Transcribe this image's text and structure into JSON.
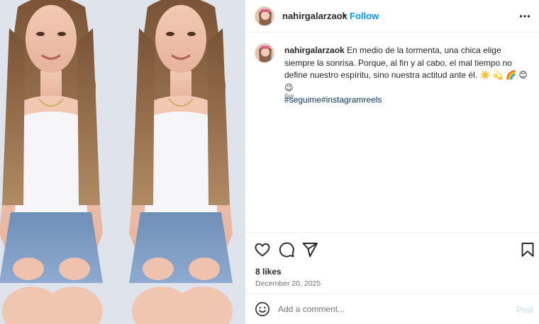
{
  "post": {
    "username": "nahirgalarzaok",
    "dot": "•",
    "follow_label": "Follow",
    "caption_text": "En medio de la tormenta, una chica elige siempre la sonrisa. Porque, al fin y al cabo, el mal tiempo no define nuestro espíritu, sino nuestra actitud ante él. ☀️ 💫 🌈 😊 😉",
    "hashtags": "#seguime#instagramreels",
    "time_ago": "6w",
    "likes": "8 likes",
    "date": "December 20, 2025"
  },
  "comment": {
    "placeholder": "Add a comment...",
    "post_label": "Post"
  },
  "icons": {
    "more": "more-options-icon",
    "like": "heart-icon",
    "comment": "comment-icon",
    "share": "send-icon",
    "save": "bookmark-icon",
    "emoji": "emoji-icon"
  },
  "colors": {
    "accent": "#0095f6",
    "hashtag": "#00376b",
    "post_disabled": "#b2dffc",
    "secondary_text": "#737373"
  }
}
